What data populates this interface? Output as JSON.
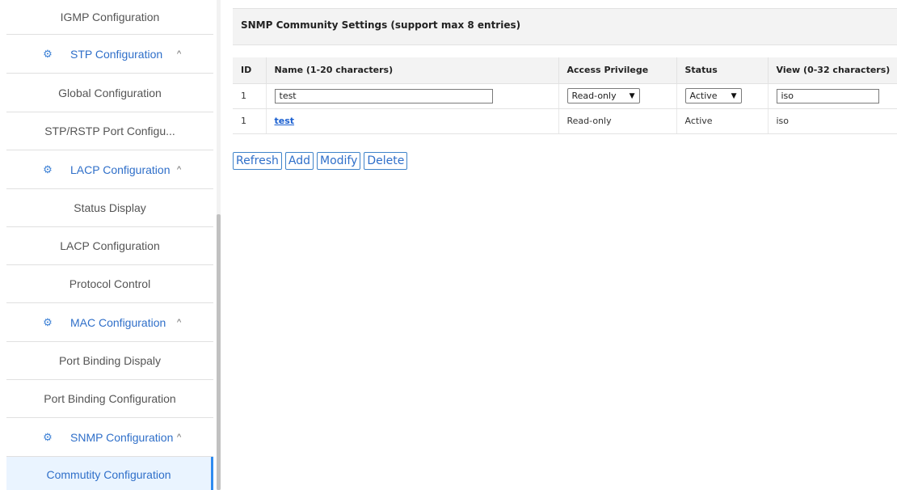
{
  "sidebar": {
    "items": [
      {
        "type": "sub",
        "label": "IGMP Configuration"
      },
      {
        "type": "group",
        "label": "STP Configuration",
        "icon": "gear-icon"
      },
      {
        "type": "sub",
        "label": "Global Configuration"
      },
      {
        "type": "sub",
        "label": "STP/RSTP Port Configu..."
      },
      {
        "type": "group",
        "label": "LACP Configuration",
        "icon": "gear-icon"
      },
      {
        "type": "sub",
        "label": "Status Display"
      },
      {
        "type": "sub",
        "label": "LACP Configuration"
      },
      {
        "type": "sub",
        "label": "Protocol Control"
      },
      {
        "type": "group",
        "label": "MAC Configuration",
        "icon": "gear-icon"
      },
      {
        "type": "sub",
        "label": "Port Binding Dispaly"
      },
      {
        "type": "sub",
        "label": "Port Binding Configuration"
      },
      {
        "type": "group",
        "label": "SNMP Configuration",
        "icon": "gear-icon"
      },
      {
        "type": "sub",
        "label": "Commutity Configuration",
        "active": true
      }
    ]
  },
  "panel": {
    "title": "SNMP Community Settings (support max 8 entries)"
  },
  "table": {
    "headers": [
      "ID",
      "Name (1-20 characters)",
      "Access Privilege",
      "Status",
      "View (0-32 characters)"
    ],
    "edit_row": {
      "id": "1",
      "name_value": "test",
      "access_value": "Read-only",
      "status_value": "Active",
      "view_value": "iso"
    },
    "rows": [
      {
        "id": "1",
        "name": "test",
        "access": "Read-only",
        "status": "Active",
        "view": "iso"
      }
    ]
  },
  "buttons": {
    "refresh": "Refresh",
    "add": "Add",
    "modify": "Modify",
    "delete": "Delete"
  },
  "colors": {
    "accent": "#2f6fc9",
    "active_bg": "#eaf4ff"
  }
}
